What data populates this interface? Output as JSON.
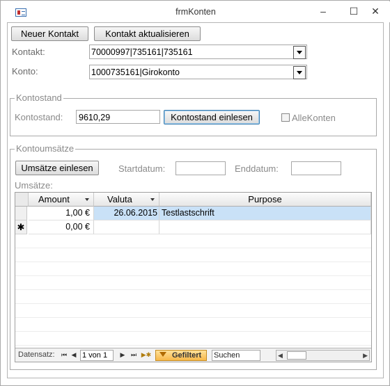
{
  "window": {
    "title": "frmKonten",
    "minimize": "–",
    "maximize": "☐",
    "close": "✕"
  },
  "toolbar": {
    "new_contact": "Neuer Kontakt",
    "update_contact": "Kontakt aktualisieren"
  },
  "kontakt": {
    "label": "Kontakt:",
    "value": "70000997|735161|735161"
  },
  "konto": {
    "label": "Konto:",
    "value": "1000735161|Girokonto"
  },
  "kontostand_group": {
    "legend": "Kontostand",
    "label": "Kontostand:",
    "value": "9610,29",
    "read_button": "Kontostand einlesen",
    "all_accounts_label": "AlleKonten",
    "all_accounts_checked": false
  },
  "umsaetze_group": {
    "legend": "Kontoumsätze",
    "read_button": "Umsätze einlesen",
    "start_label": "Startdatum:",
    "start_value": "",
    "end_label": "Enddatum:",
    "end_value": "",
    "list_label": "Umsätze:"
  },
  "grid": {
    "columns": [
      "Amount",
      "Valuta",
      "Purpose"
    ],
    "rows": [
      {
        "amount": "1,00 €",
        "valuta": "26.06.2015",
        "purpose": "Testlastschrift"
      },
      {
        "amount": "0,00 €",
        "valuta": "",
        "purpose": "",
        "new_row_marker": "✱"
      }
    ]
  },
  "navigation": {
    "record_label": "Datensatz:",
    "first": "⏮",
    "prev": "◀",
    "position": "1 von 1",
    "next": "▶",
    "last": "⏭",
    "new": "▶✱",
    "filter_label": "Gefiltert",
    "search_placeholder": "Suchen"
  },
  "colors": {
    "selected_row": "#c9e1f7",
    "filter_accent": "#f7b84a"
  }
}
